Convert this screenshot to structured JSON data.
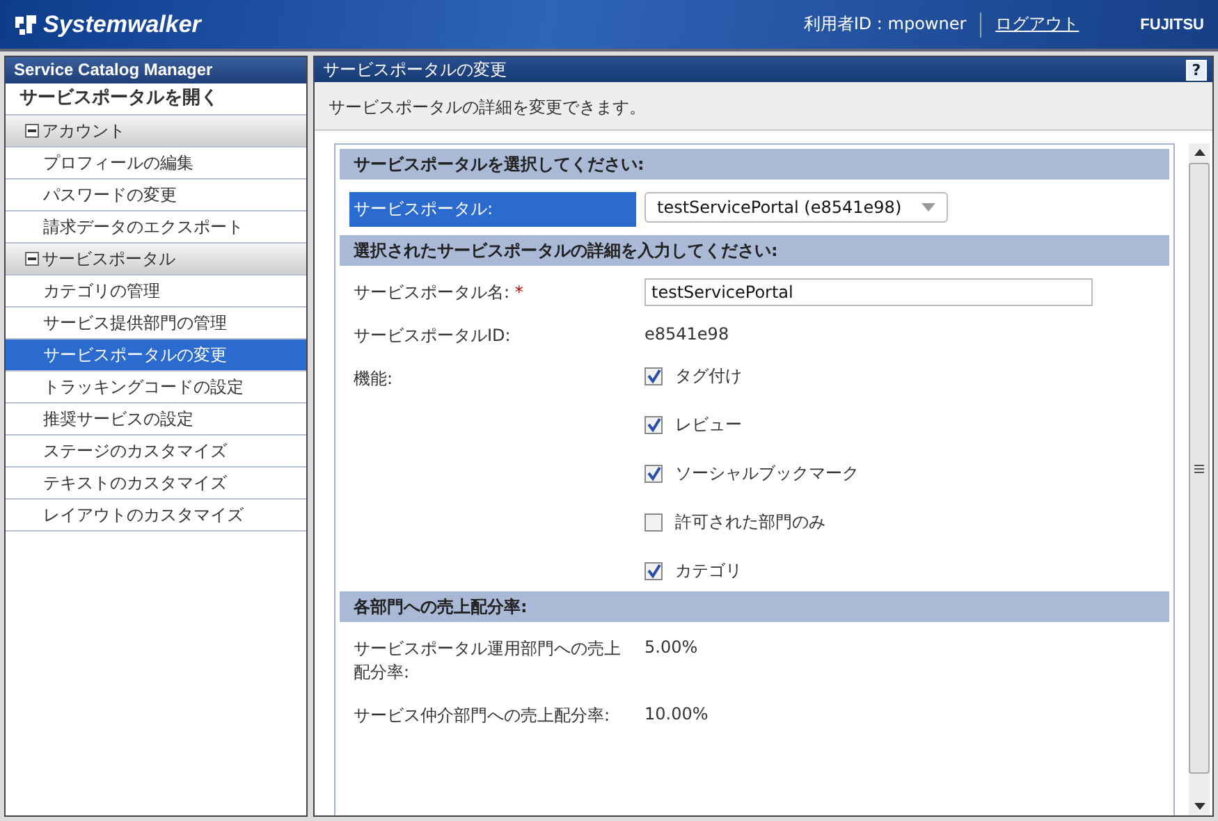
{
  "header": {
    "logo": "Systemwalker",
    "user": "利用者ID : mpowner",
    "logout": "ログアウト",
    "brand": "FUJITSU"
  },
  "sidebar": {
    "title": "Service Catalog Manager",
    "items": [
      {
        "kind": "top",
        "label": "サービスポータルを開く"
      },
      {
        "kind": "group",
        "label": "アカウント",
        "expanded": true,
        "children": [
          {
            "label": "プロフィールの編集",
            "selected": false
          },
          {
            "label": "パスワードの変更",
            "selected": false
          },
          {
            "label": "請求データのエクスポート",
            "selected": false
          }
        ]
      },
      {
        "kind": "group",
        "label": "サービスポータル",
        "expanded": true,
        "children": [
          {
            "label": "カテゴリの管理",
            "selected": false
          },
          {
            "label": "サービス提供部門の管理",
            "selected": false
          },
          {
            "label": "サービスポータルの変更",
            "selected": true
          },
          {
            "label": "トラッキングコードの設定",
            "selected": false
          },
          {
            "label": "推奨サービスの設定",
            "selected": false
          },
          {
            "label": "ステージのカスタマイズ",
            "selected": false
          },
          {
            "label": "テキストのカスタマイズ",
            "selected": false
          },
          {
            "label": "レイアウトのカスタマイズ",
            "selected": false
          }
        ]
      }
    ]
  },
  "main": {
    "title": "サービスポータルの変更",
    "help": "?",
    "description": "サービスポータルの詳細を変更できます。",
    "sections": [
      {
        "heading": "サービスポータルを選択してください:",
        "rows": [
          {
            "kind": "select",
            "label": "サービスポータル:",
            "highlighted": true,
            "value": "testServicePortal (e8541e98)"
          }
        ]
      },
      {
        "heading": "選択されたサービスポータルの詳細を入力してください:",
        "rows": [
          {
            "kind": "input",
            "label": "サービスポータル名:",
            "required": "*",
            "value": "testServicePortal"
          },
          {
            "kind": "text",
            "label": "サービスポータルID:",
            "value": "e8541e98"
          },
          {
            "kind": "checks",
            "label": "機能:",
            "options": [
              {
                "label": "タグ付け",
                "checked": true
              },
              {
                "label": "レビュー",
                "checked": true
              },
              {
                "label": "ソーシャルブックマーク",
                "checked": true
              },
              {
                "label": "許可された部門のみ",
                "checked": false
              },
              {
                "label": "カテゴリ",
                "checked": true
              }
            ]
          }
        ]
      },
      {
        "heading": "各部門への売上配分率:",
        "rows": [
          {
            "kind": "text",
            "label": "サービスポータル運用部門への売上配分率:",
            "value": "5.00%"
          },
          {
            "kind": "text",
            "label": "サービス仲介部門への売上配分率:",
            "value": "10.00%"
          }
        ]
      }
    ]
  }
}
